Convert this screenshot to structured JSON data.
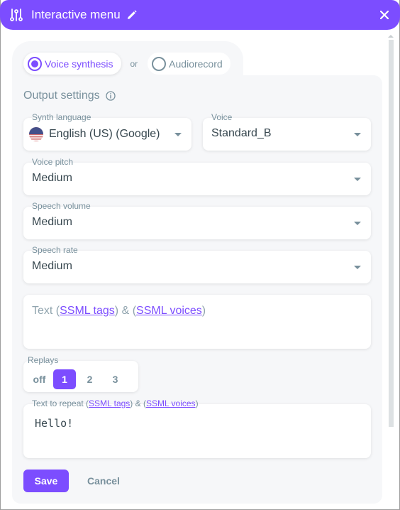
{
  "header": {
    "title": "Interactive menu",
    "icon": "tune-icon",
    "edit_icon": "pencil-icon",
    "close_icon": "close-icon",
    "background": "#7c4dff"
  },
  "mode": {
    "options": [
      {
        "label": "Voice synthesis",
        "selected": true
      },
      {
        "label": "Audiorecord",
        "selected": false
      }
    ],
    "separator": "or"
  },
  "output_settings": {
    "title": "Output settings",
    "info_icon": "info-icon"
  },
  "fields": {
    "synth_language": {
      "label": "Synth language",
      "value": "English (US) (Google)",
      "flag": "us-flag-icon"
    },
    "voice": {
      "label": "Voice",
      "value": "Standard_B"
    },
    "voice_pitch": {
      "label": "Voice pitch",
      "value": "Medium"
    },
    "speech_volume": {
      "label": "Speech volume",
      "value": "Medium"
    },
    "speech_rate": {
      "label": "Speech rate",
      "value": "Medium"
    }
  },
  "text_field": {
    "prefix": "Text (",
    "link1": "SSML tags",
    "middle": ") & (",
    "link2": "SSML voices",
    "suffix": ")"
  },
  "replays": {
    "label": "Replays",
    "options": [
      "off",
      "1",
      "2",
      "3"
    ],
    "selected": "1"
  },
  "repeat_text": {
    "label_prefix": "Text to repeat (",
    "link1": "SSML tags",
    "middle": ") & (",
    "link2": "SSML voices",
    "suffix": ")",
    "value": "Hello!"
  },
  "actions": {
    "save_label": "Save",
    "cancel_label": "Cancel"
  },
  "colors": {
    "accent": "#7c4dff",
    "muted": "#78909c",
    "panel_bg": "#f6f7f9"
  }
}
